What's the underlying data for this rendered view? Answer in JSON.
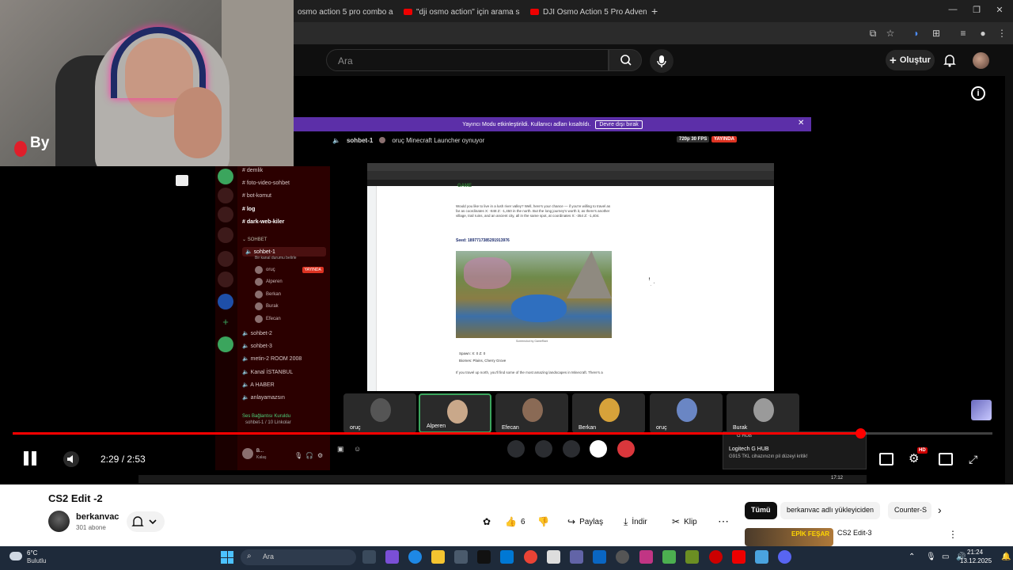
{
  "browser": {
    "tabs": [
      {
        "title": "osmo action 5 pro combo a"
      },
      {
        "title": "\"dji osmo action\" için arama so"
      },
      {
        "title": "DJI Osmo Action 5 Pro Advent"
      }
    ],
    "new_tab": "+"
  },
  "youtube_header": {
    "search_placeholder": "Ara",
    "create_label": "Oluştur"
  },
  "overlay": {
    "streamer_logo": "By"
  },
  "discord": {
    "yayinci_notice": "Yayıncı Modu etkinleştirildi. Kullanıcı adları kısaltıldı.",
    "yayinci_button": "Devre dışı bırak",
    "stream_channel": "sohbet-1",
    "stream_activity": "oruç Minecraft Launcher oynuyor",
    "fps_badge": "720p 30 FPS",
    "live_badge": "YAYINDA",
    "channels": [
      {
        "name": "demlik"
      },
      {
        "name": "foto-video-sohbet"
      },
      {
        "name": "bot-komut"
      },
      {
        "name": "log"
      },
      {
        "name": "dark-web-kiler"
      }
    ],
    "category_voice": "SOHBET",
    "active_voice": "sohbet-1",
    "active_voice_sub": "Bir kanal durumu belirle",
    "voice_users": [
      {
        "name": "oruç",
        "live": "YAYINDA"
      },
      {
        "name": "Alperen"
      },
      {
        "name": "Berkan"
      },
      {
        "name": "Burak"
      },
      {
        "name": "Efecan"
      }
    ],
    "other_channels": [
      {
        "name": "sohbet-2"
      },
      {
        "name": "sohbet-3"
      },
      {
        "name": "metin-2 ROOM 2008"
      },
      {
        "name": "Kanal İSTANBUL"
      },
      {
        "name": "A HABER"
      },
      {
        "name": "anlayamazsın"
      }
    ],
    "voice_status": "Ses Bağlantısı Kuruldu",
    "voice_status_sub": "sohbet-1 / 10 Linkolar",
    "self_name": "B...",
    "self_sub": "Kalaş",
    "tiles": [
      {
        "name": "oruç"
      },
      {
        "name": "Alperen"
      },
      {
        "name": "Efecan"
      },
      {
        "name": "Berkan"
      },
      {
        "name": "oruç"
      },
      {
        "name": "Burak"
      }
    ],
    "webpage": {
      "site": "GAME",
      "seed": "Seed: 1897717385291913976",
      "para1": "Would you like to live in a lush river valley? Well, here's your chance — if you're willing to travel as far as coordinates X: -848 Z: -1,450 in the north. But the long journey's worth it, as there's another village, trail ruins, and an ancient city, all in the same spot, at coordinates X: -354 Z: -1,404.",
      "caption": "Screenshot by GameRant",
      "spawn": "Spawn: X: 0 Z: 0",
      "biomes": "Biomes: Plains, Cherry Grove",
      "para2": "If you travel up north, you'll find some of the most amazing landscapes in Minecraft. There's a"
    }
  },
  "toast": {
    "app": "G HUB",
    "title": "Logitech G HUB",
    "message": "G915 TKL cihazınızın pil düzeyi kritik!"
  },
  "inner_taskbar": {
    "clock": "17:12"
  },
  "player": {
    "time_current": "2:29",
    "time_sep": " / ",
    "time_total": "2:53",
    "progress": 0.865,
    "hd_badge": "HD"
  },
  "video": {
    "title": "CS2 Edit -2",
    "channel_name": "berkanvac",
    "subscribers": "301 abone",
    "likes": "6",
    "share": "Paylaş",
    "download": "İndir",
    "clip": "Klip"
  },
  "recommendations": {
    "chips": [
      "Tümü",
      "berkanvac adlı yükleyiciden",
      "Counter-S"
    ],
    "first_title": "CS2 Edit-3",
    "first_thumb_text": "EPİK FEŞAR"
  },
  "taskbar": {
    "temp": "6°C",
    "weather": "Bulutlu",
    "search": "Ara",
    "time": "21:24",
    "date": "13.12.2025"
  },
  "colors": {
    "youtube_red": "#ff0000",
    "discord_purple": "#5c2fa8",
    "live_red": "#dd3322",
    "win_accent": "#4cc2ff"
  }
}
